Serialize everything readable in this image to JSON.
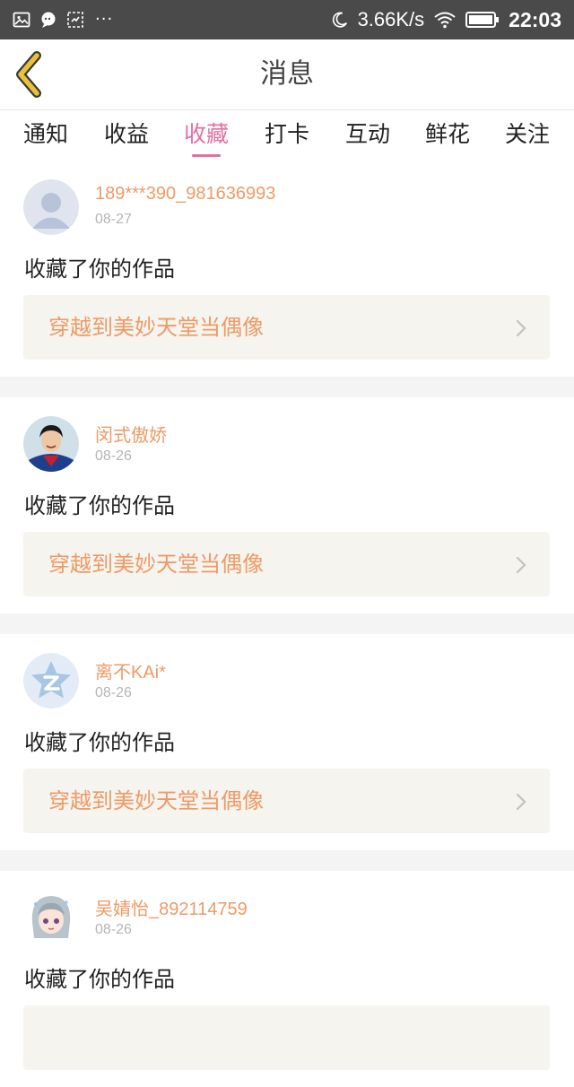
{
  "status_bar": {
    "speed": "3.66K/s",
    "time": "22:03",
    "icons": [
      "image-icon",
      "chat-icon",
      "screenshot-icon",
      "more-dots-icon",
      "moon-icon",
      "wifi-icon",
      "battery-icon"
    ]
  },
  "header": {
    "title": "消息",
    "back_icon": "chevron-left-icon",
    "back_color": "#e9c23a"
  },
  "tabs": [
    {
      "label": "通知"
    },
    {
      "label": "收益"
    },
    {
      "label": "收藏",
      "active": true
    },
    {
      "label": "打卡"
    },
    {
      "label": "互动"
    },
    {
      "label": "鲜花"
    },
    {
      "label": "关注"
    }
  ],
  "colors": {
    "accent_pink": "#e46fa1",
    "username_orange": "#ee9a66",
    "card_bg": "#f5f4ef"
  },
  "feed": [
    {
      "user": "189***390_981636993",
      "date": "08-27",
      "action": "收藏了你的作品",
      "work": "穿越到美妙天堂当偶像",
      "avatar": "default-avatar-icon"
    },
    {
      "user": "闵式傲娇",
      "date": "08-26",
      "action": "收藏了你的作品",
      "work": "穿越到美妙天堂当偶像",
      "avatar": "photo-avatar"
    },
    {
      "user": "离不KAi*",
      "date": "08-26",
      "action": "收藏了你的作品",
      "work": "穿越到美妙天堂当偶像",
      "avatar": "qq-star-avatar-icon"
    },
    {
      "user": "吴婧怡_892114759",
      "date": "08-26",
      "action": "收藏了你的作品",
      "work": "",
      "avatar": "anime-avatar"
    }
  ]
}
